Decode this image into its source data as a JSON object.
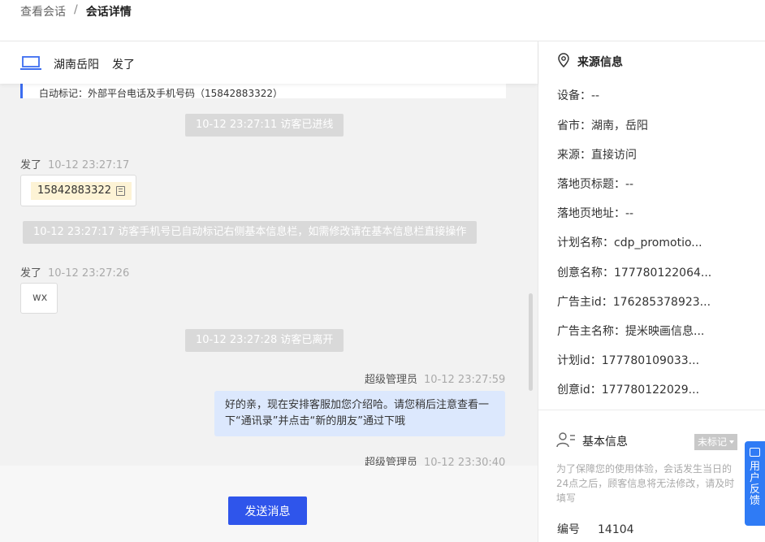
{
  "breadcrumb": {
    "parent": "查看会话",
    "separator": "/",
    "current": "会话详情"
  },
  "visitor": {
    "location": "湖南岳阳",
    "name": "发了"
  },
  "chat": {
    "cut_text": "白动标记：外部平台电话及手机号码（15842883322）",
    "system_enter": "10-12 23:27:11 访客已进线",
    "msg1_sender": "发了",
    "msg1_time": "10-12 23:27:17",
    "msg1_phone": "15842883322",
    "system_mark": "10-12 23:27:17 访客手机号已自动标记右侧基本信息栏，如需修改请在基本信息栏直接操作",
    "msg2_sender": "发了",
    "msg2_time": "10-12 23:27:26",
    "msg2_text": "wx",
    "system_leave": "10-12 23:27:28 访客已离开",
    "agent_name": "超级管理员",
    "agent_time": "10-12 23:27:59",
    "agent_text": "好的亲，现在安排客服加您介绍哈。请您稍后注意查看一下“通讯录”并点击“新的朋友”通过下哦",
    "agent2_name": "超级管理员",
    "agent2_time": "10-12 23:30:40"
  },
  "composer": {
    "send_label": "发送消息"
  },
  "source": {
    "title": "来源信息",
    "device": "设备：--",
    "province": "省市：湖南，岳阳",
    "origin": "来源：直接访问",
    "landing_title": "落地页标题：--",
    "landing_url": "落地页地址：--",
    "plan_name": "计划名称：cdp_promotio...",
    "creative_name": "创意名称：177780122064...",
    "advertiser_id": "广告主id：176285378923...",
    "advertiser_name": "广告主名称：提米映画信息...",
    "plan_id": "计划id：177780109033...",
    "creative_id": "创意id：177780122029..."
  },
  "basic": {
    "title": "基本信息",
    "tag": "未标记",
    "note": "为了保障您的使用体验，会话发生当日的24点之后，顾客信息将无法修改，请及时填写",
    "number_label": "编号",
    "number_value": "14104"
  },
  "feedback": {
    "label": "用户反馈"
  },
  "colors": {
    "primary": "#2f55eb",
    "agent_bubble": "#dce8fd",
    "phone_pill": "#fdf3d5"
  }
}
